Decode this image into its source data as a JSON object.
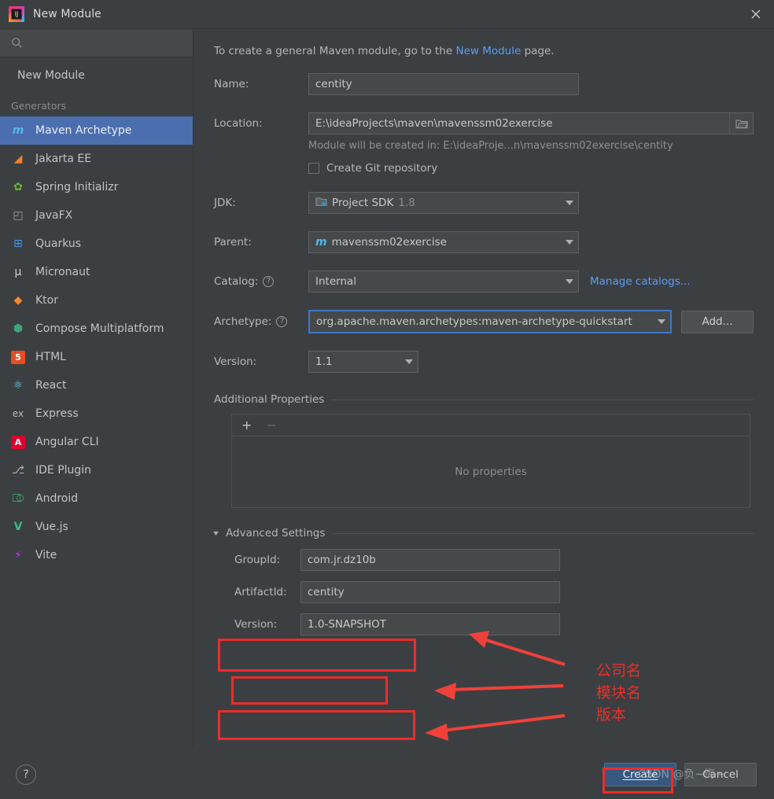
{
  "window": {
    "title": "New Module",
    "logo_icon": "intellij-idea-logo",
    "close_icon": "close-icon"
  },
  "sidebar": {
    "search": {
      "value": "",
      "placeholder": "",
      "icon": "search-icon"
    },
    "top_item": {
      "label": "New Module"
    },
    "group_label": "Generators",
    "items": [
      {
        "label": "Maven Archetype",
        "icon": "maven-icon",
        "glyph": "m",
        "color": "#53b7e8",
        "selected": true
      },
      {
        "label": "Jakarta EE",
        "icon": "jakarta-ee-icon",
        "glyph": "◢",
        "color": "#f58025",
        "selected": false
      },
      {
        "label": "Spring Initializr",
        "icon": "spring-icon",
        "glyph": "✿",
        "color": "#6db33f",
        "selected": false
      },
      {
        "label": "JavaFX",
        "icon": "javafx-icon",
        "glyph": "◰",
        "color": "#9aa0a3",
        "selected": false
      },
      {
        "label": "Quarkus",
        "icon": "quarkus-icon",
        "glyph": "⊞",
        "color": "#4695eb",
        "selected": false
      },
      {
        "label": "Micronaut",
        "icon": "micronaut-icon",
        "glyph": "μ",
        "color": "#cfcfcf",
        "selected": false
      },
      {
        "label": "Ktor",
        "icon": "ktor-icon",
        "glyph": "◆",
        "color": "#f28a2e",
        "selected": false
      },
      {
        "label": "Compose Multiplatform",
        "icon": "compose-icon",
        "glyph": "⬢",
        "color": "#3ea37a",
        "selected": false
      },
      {
        "label": "HTML",
        "icon": "html5-icon",
        "glyph": "5",
        "color": "#e44d26",
        "selected": false
      },
      {
        "label": "React",
        "icon": "react-icon",
        "glyph": "⚛",
        "color": "#61dafb",
        "selected": false
      },
      {
        "label": "Express",
        "icon": "express-icon",
        "glyph": "ex",
        "color": "#b9b9b9",
        "selected": false
      },
      {
        "label": "Angular CLI",
        "icon": "angular-icon",
        "glyph": "A",
        "color": "#dd0031",
        "selected": false
      },
      {
        "label": "IDE Plugin",
        "icon": "ide-plugin-icon",
        "glyph": "⎇",
        "color": "#b0b0b0",
        "selected": false
      },
      {
        "label": "Android",
        "icon": "android-icon",
        "glyph": "⎄",
        "color": "#3ddc84",
        "selected": false
      },
      {
        "label": "Vue.js",
        "icon": "vuejs-icon",
        "glyph": "V",
        "color": "#41b883",
        "selected": false
      },
      {
        "label": "Vite",
        "icon": "vite-icon",
        "glyph": "⚡",
        "color": "#bd34fe",
        "selected": false
      }
    ]
  },
  "main": {
    "intro_prefix": "To create a general Maven module, go to the ",
    "intro_link": "New Module",
    "intro_suffix": " page.",
    "name": {
      "label": "Name:",
      "value": "centity",
      "placeholder": ""
    },
    "location": {
      "label": "Location:",
      "value": "E:\\ideaProjects\\maven\\mavenssm02exercise",
      "placeholder": "",
      "browse_icon": "folder-icon",
      "hint": "Module will be created in: E:\\ideaProje...n\\mavenssm02exercise\\centity"
    },
    "git": {
      "label": "Create Git repository",
      "checked": false
    },
    "jdk": {
      "label": "JDK:",
      "value": "Project SDK",
      "version": "1.8",
      "icon": "jdk-icon"
    },
    "parent": {
      "label": "Parent:",
      "value": "mavenssm02exercise",
      "icon": "maven-icon",
      "glyph": "m"
    },
    "catalog": {
      "label": "Catalog:",
      "value": "Internal",
      "help_icon": "help-circle-icon",
      "manage_link": "Manage catalogs..."
    },
    "archetype": {
      "label": "Archetype:",
      "value": "org.apache.maven.archetypes:maven-archetype-quickstart",
      "help_icon": "help-circle-icon",
      "add_button": "Add...",
      "focused": true
    },
    "version_field": {
      "label": "Version:",
      "value": "1.1"
    },
    "additional_properties": {
      "section_title": "Additional Properties",
      "add_icon": "plus-icon",
      "remove_icon": "minus-icon",
      "empty_text": "No properties"
    },
    "advanced": {
      "section_title": "Advanced Settings",
      "caret_icon": "chevron-down-icon",
      "group_id": {
        "label": "GroupId:",
        "value": "com.jr.dz10b"
      },
      "artifact_id": {
        "label": "ArtifactId:",
        "value": "centity"
      },
      "version": {
        "label": "Version:",
        "value": "1.0-SNAPSHOT"
      }
    }
  },
  "footer": {
    "help_icon": "help-icon",
    "create_button": "Create",
    "cancel_button": "Cancel"
  },
  "annotations": {
    "color": "#ee2b2b",
    "labels": [
      "公司名",
      "模块名",
      "版本"
    ],
    "watermark": "CSDN @负~悔~"
  }
}
